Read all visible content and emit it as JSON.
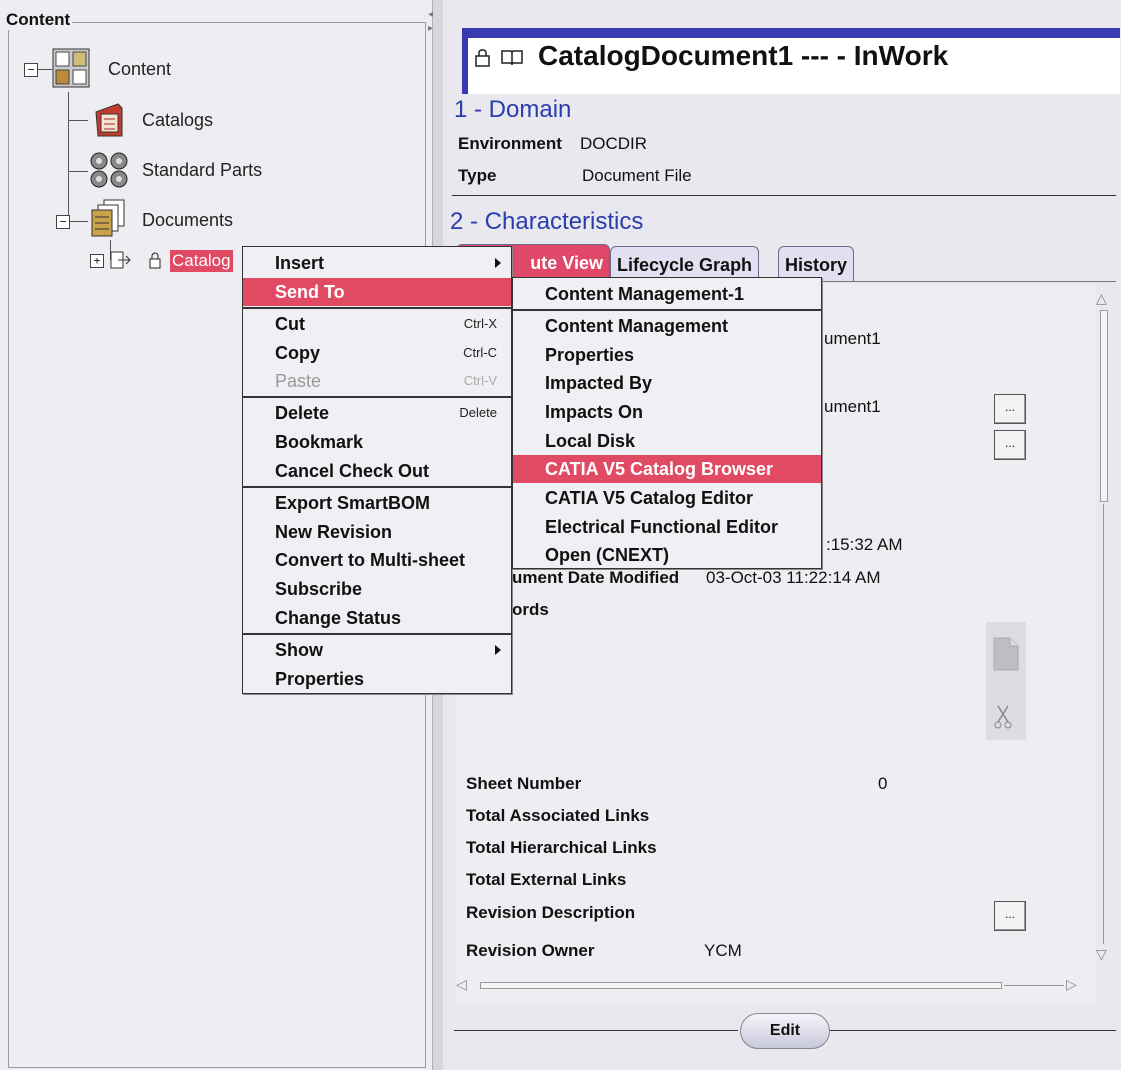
{
  "tree": {
    "panel_title": "Content",
    "root_label": "Content",
    "items": [
      "Catalogs",
      "Standard Parts",
      "Documents"
    ],
    "selected_label": "Catalog"
  },
  "document": {
    "title": "CatalogDocument1 --- - InWork",
    "domain_heading": "1 - Domain",
    "environment_label": "Environment",
    "environment_value": "DOCDIR",
    "type_label": "Type",
    "type_value": "Document File",
    "characteristics_heading": "2 - Characteristics",
    "tabs": [
      "Attribute View",
      "Lifecycle Graph",
      "History"
    ],
    "tab_visible_text": "ute View",
    "partial_values": [
      "ument1",
      "ument1",
      ":15:32 AM"
    ],
    "date_modified_label": "ument Date Modified",
    "date_modified_value": "03-Oct-03 11:22:14 AM",
    "keywords_label": "ords",
    "sheet_number_label": "Sheet Number",
    "sheet_number_value": "0",
    "total_associated_label": "Total Associated Links",
    "total_hierarchical_label": "Total Hierarchical Links",
    "total_external_label": "Total External Links",
    "revision_description_label": "Revision Description",
    "revision_owner_label": "Revision Owner",
    "revision_owner_value": "YCM",
    "ellipsis": "...",
    "edit_label": "Edit"
  },
  "context_menu": {
    "insert": "Insert",
    "send_to": "Send To",
    "cut": "Cut",
    "cut_sc": "Ctrl-X",
    "copy": "Copy",
    "copy_sc": "Ctrl-C",
    "paste": "Paste",
    "paste_sc": "Ctrl-V",
    "delete": "Delete",
    "delete_sc": "Delete",
    "bookmark": "Bookmark",
    "cancel_check_out": "Cancel Check Out",
    "export_smartbom": "Export SmartBOM",
    "new_revision": "New Revision",
    "convert_multisheet": "Convert to Multi-sheet",
    "subscribe": "Subscribe",
    "change_status": "Change Status",
    "show": "Show",
    "properties": "Properties"
  },
  "submenu": {
    "items": [
      "Content Management-1",
      "Content Management",
      "Properties",
      "Impacted By",
      "Impacts On",
      "Local Disk",
      "CATIA V5 Catalog Browser",
      "CATIA V5 Catalog Editor",
      "Electrical Functional Editor",
      "Open (CNEXT)"
    ],
    "highlighted_index": 6
  },
  "colors": {
    "highlight": "#e14a63",
    "heading_blue": "#2a3cae",
    "title_bar_blue": "#3a3ab0"
  },
  "icons": [
    "tree-collapse-icon",
    "content-grid-icon",
    "catalogs-book-icon",
    "standard-parts-icon",
    "documents-icon",
    "lock-icon",
    "book-icon",
    "ellipsis-icon",
    "scroll-up-icon",
    "scroll-down-icon",
    "scroll-left-icon",
    "scroll-right-icon",
    "new-doc-icon",
    "scissors-icon",
    "submenu-arrow-icon"
  ]
}
